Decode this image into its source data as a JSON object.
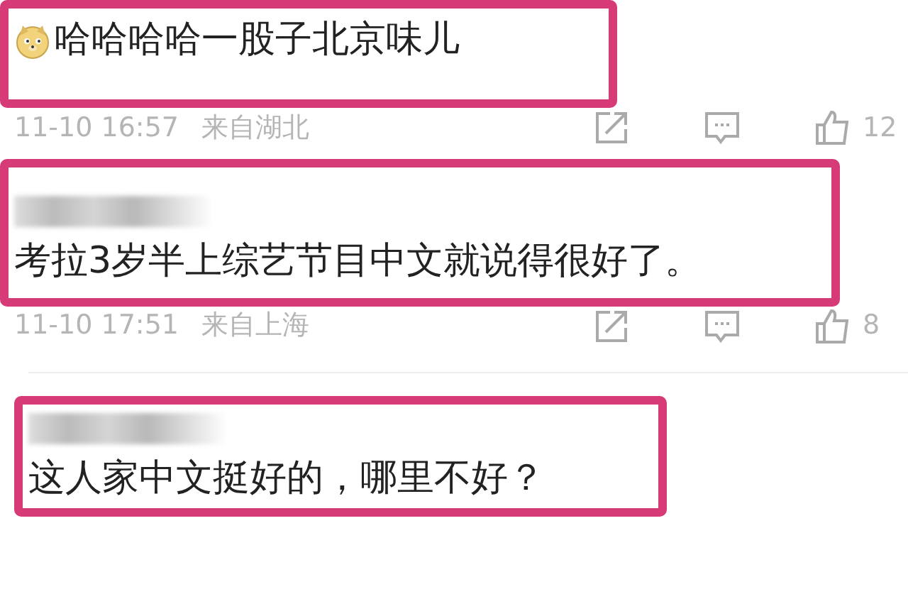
{
  "comments": [
    {
      "emoji": true,
      "username_hidden": false,
      "text": "哈哈哈哈一股子北京味儿",
      "highlighted": true,
      "meta": {
        "time": "11-10 16:57",
        "location": "来自湖北",
        "likes": "12"
      }
    },
    {
      "emoji": false,
      "username_hidden": true,
      "text": "考拉3岁半上综艺节目中文就说得很好了。",
      "highlighted": true,
      "meta": {
        "time": "11-10 17:51",
        "location": "来自上海",
        "likes": "8"
      }
    },
    {
      "emoji": false,
      "username_hidden": true,
      "text": "这人家中文挺好的，哪里不好？",
      "highlighted": true
    }
  ]
}
